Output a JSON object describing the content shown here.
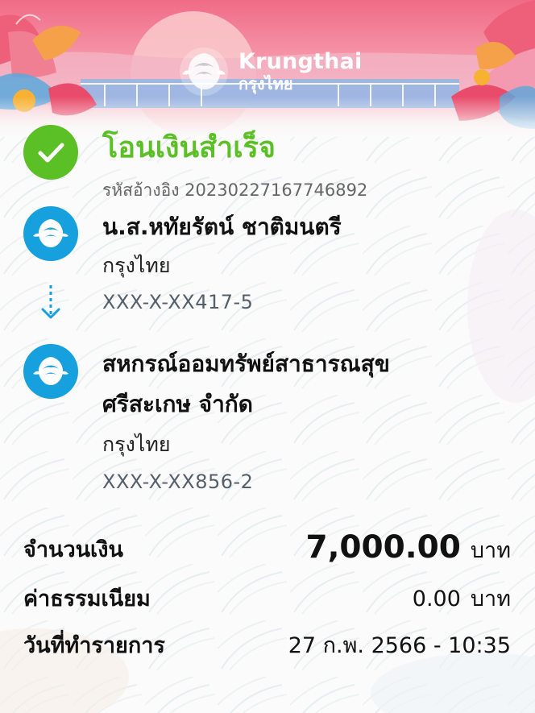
{
  "brand": {
    "name_en": "Krungthai",
    "name_th": "กรุงไทย"
  },
  "status": {
    "title": "โอนเงินสำเร็จ",
    "ref_label": "รหัสอ้างอิง",
    "ref_number": "20230227167746892",
    "icon": "check-circle-icon",
    "color": "#5bbf26"
  },
  "sender": {
    "name": "น.ส.หทัยรัตน์ ชาติมนตรี",
    "bank": "กรุงไทย",
    "account": "XXX-X-XX417-5",
    "logo": "krungthai-logo-icon"
  },
  "receiver": {
    "name_line1": "สหกรณ์ออมทรัพย์สาธารณสุข",
    "name_line2": "ศรีสะเกษ จำกัด",
    "bank": "กรุงไทย",
    "account": "XXX-X-XX856-2",
    "logo": "krungthai-logo-icon"
  },
  "summary": {
    "amount_label": "จำนวนเงิน",
    "amount_value": "7,000.00",
    "amount_unit": "บาท",
    "fee_label": "ค่าธรรมเนียม",
    "fee_value": "0.00",
    "fee_unit": "บาท",
    "date_label": "วันที่ทำรายการ",
    "date_value": "27 ก.พ. 2566 - 10:35"
  },
  "colors": {
    "brand_blue": "#16a0dd",
    "success_green": "#5bbf26",
    "account_gray": "#555f6b"
  }
}
